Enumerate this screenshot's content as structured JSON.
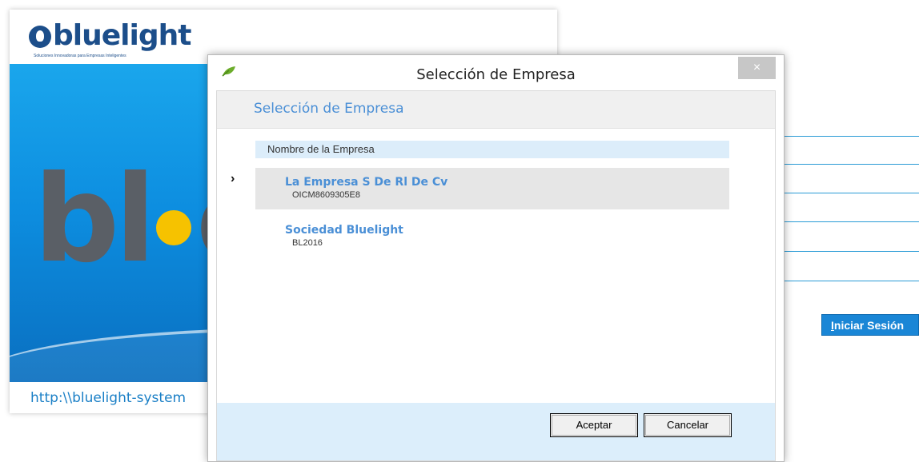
{
  "login_window": {
    "logo_text": "bluelight",
    "tagline": "Soluciones Innovadoras para Empresas Inteligentes",
    "splash_letters_left": "bl",
    "splash_letters_right": "e",
    "url": "http:\\\\bluelight-system"
  },
  "login_form": {
    "login_button_mnemonic": "I",
    "login_button_rest": "niciar Sesión"
  },
  "dialog": {
    "title": "Selección de Empresa",
    "close_glyph": "×",
    "header": "Selección de Empresa",
    "column_header": "Nombre de la Empresa",
    "row_indicator": "›",
    "companies": [
      {
        "name": "La Empresa S De Rl De Cv",
        "code": "OICM8609305E8"
      },
      {
        "name": "Sociedad Bluelight",
        "code": "BL2016"
      }
    ],
    "accept_label": "Aceptar",
    "cancel_label": "Cancelar"
  },
  "colors": {
    "accent_blue": "#4a8fd6",
    "splash_blue": "#1aa6ec",
    "footer_band": "#dceefb",
    "brand_green": "#6cad2b"
  },
  "icons": {
    "app_icon": "leaf-icon",
    "close_icon": "close-icon",
    "row_indicator": "chevron-right-icon"
  }
}
